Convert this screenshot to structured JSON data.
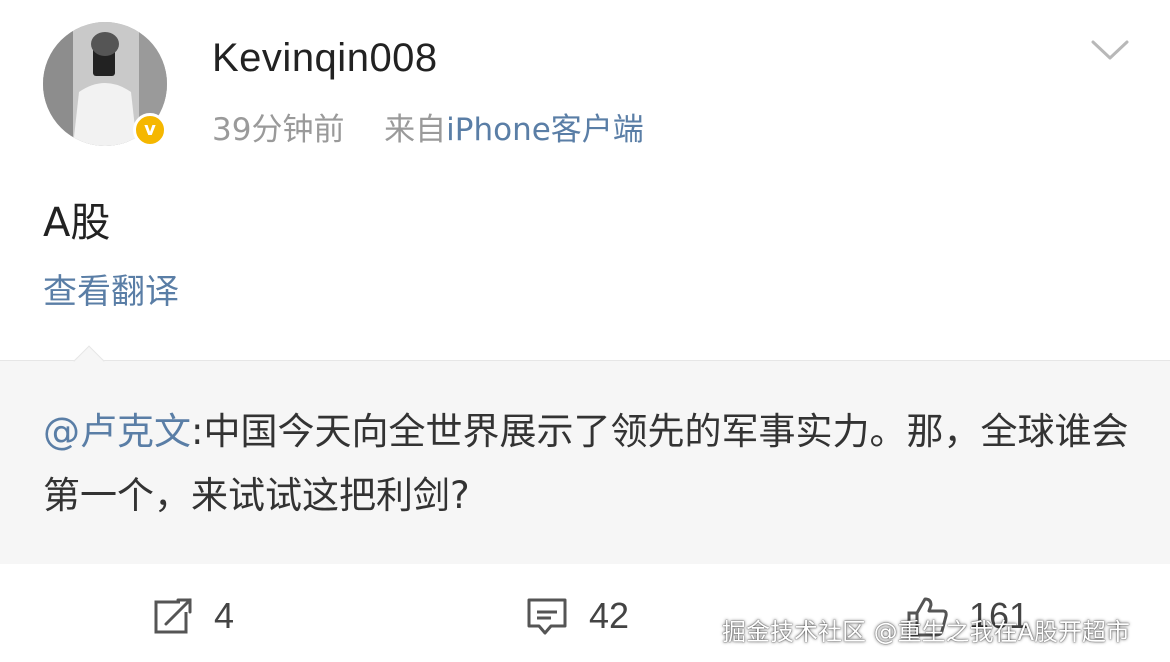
{
  "post": {
    "username": "Kevinqin008",
    "time": "39分钟前",
    "source_prefix": "来自",
    "source": "iPhone客户端",
    "verified_badge": "v",
    "text": "A股",
    "translate_link": "查看翻译"
  },
  "quote": {
    "mention": "@卢克文",
    "text": ":中国今天向全世界展示了领先的军事实力。那，全球谁会第一个，来试试这把利剑?"
  },
  "actions": {
    "repost_count": "4",
    "comment_count": "42",
    "like_count": "161"
  },
  "watermark": "掘金技术社区 @重生之我在A股开超市",
  "icons": {
    "menu": "chevron-down-icon",
    "repost": "share-arrow-icon",
    "comment": "comment-bubble-icon",
    "like": "thumbs-up-icon"
  },
  "colors": {
    "link": "#5a7ea6",
    "badge": "#f5b700",
    "quote_bg": "#f6f6f6"
  }
}
